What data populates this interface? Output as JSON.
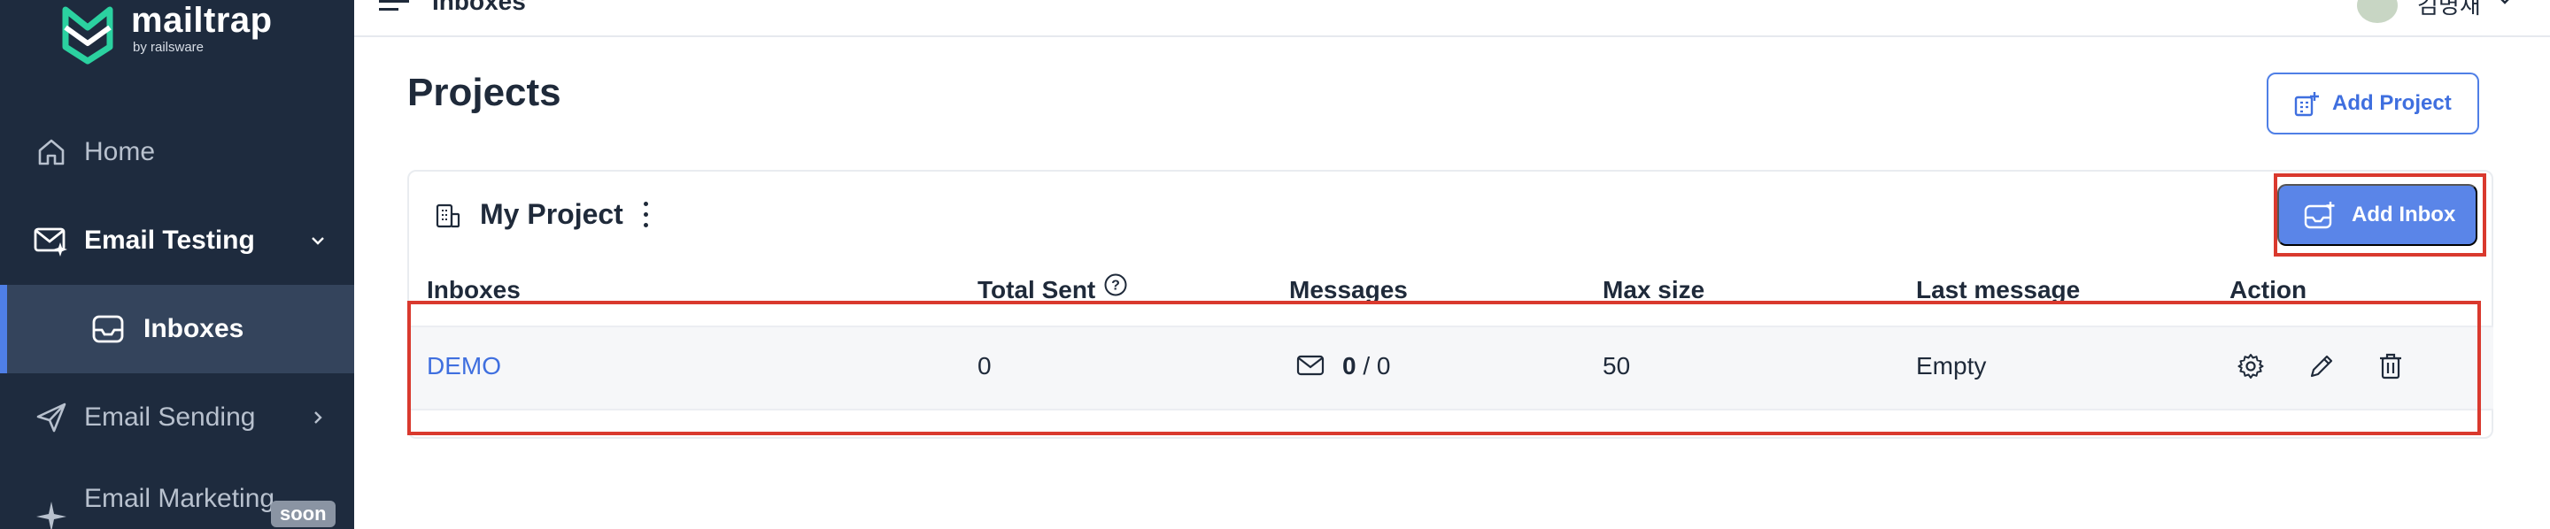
{
  "brand": {
    "name": "mailtrap",
    "by": "by railsware"
  },
  "sidebar": {
    "items": [
      {
        "label": "Home",
        "icon": "home-icon"
      },
      {
        "label": "Email Testing",
        "icon": "email-testing-icon",
        "expanded": true
      },
      {
        "label": "Inboxes",
        "icon": "inbox-icon",
        "active": true
      },
      {
        "label": "Email Sending",
        "icon": "send-icon"
      },
      {
        "label": "Email Marketing",
        "icon": "sparkle-icon",
        "badge": "soon"
      }
    ]
  },
  "header": {
    "title": "Inboxes",
    "user_name": "김명재"
  },
  "page": {
    "title": "Projects",
    "add_project_label": "Add Project"
  },
  "project": {
    "name": "My Project",
    "add_inbox_label": "Add Inbox",
    "columns": [
      "Inboxes",
      "Total Sent",
      "Messages",
      "Max size",
      "Last message",
      "Action"
    ],
    "rows": [
      {
        "inbox": "DEMO",
        "total_sent": "0",
        "messages_unread": "0",
        "messages_total": "0",
        "max_size": "50",
        "last_message": "Empty"
      }
    ]
  },
  "colors": {
    "sidebar": "#1e2b3e",
    "accent": "#4f7fe6",
    "highlight": "#d9392e"
  }
}
